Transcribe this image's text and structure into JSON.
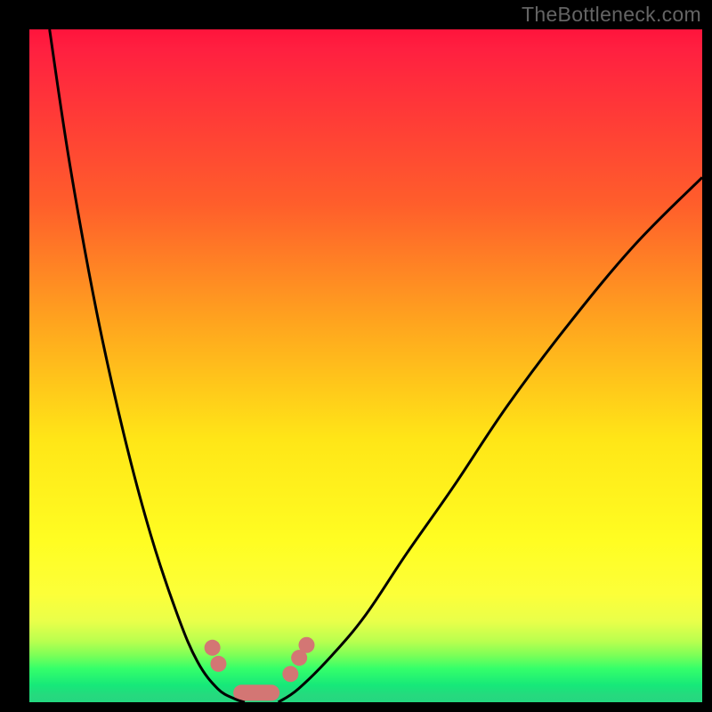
{
  "watermark": "TheBottleneck.com",
  "chart_data": {
    "type": "line",
    "title": "",
    "xlabel": "",
    "ylabel": "",
    "ylim": [
      0,
      100
    ],
    "xlim": [
      0,
      100
    ],
    "background_gradient": {
      "top_color": "#ff143c",
      "mid_color": "#fffd22",
      "bottom_color": "#23d880",
      "description": "vertical heat gradient: red (high bottleneck) at top, through orange/yellow, to green (no bottleneck) at bottom"
    },
    "series": [
      {
        "name": "left-curve",
        "description": "steep descending curve from top-left corner to trough",
        "x": [
          3,
          6,
          10,
          14,
          18,
          22,
          25,
          28,
          30.5,
          32
        ],
        "y": [
          100,
          80,
          58,
          40,
          25,
          13,
          6,
          2,
          0.5,
          0
        ]
      },
      {
        "name": "right-curve",
        "description": "ascending curve from trough toward upper right, flattening",
        "x": [
          37,
          40,
          45,
          50,
          56,
          63,
          71,
          80,
          90,
          100
        ],
        "y": [
          0,
          2,
          7,
          13,
          22,
          32,
          44,
          56,
          68,
          78
        ]
      },
      {
        "name": "highlight-segments",
        "description": "pink pill-shaped highlight markers on/near the curves at the green zone",
        "points": [
          {
            "x": 27.2,
            "y": 8.1
          },
          {
            "x": 28.1,
            "y": 5.7
          },
          {
            "x": 31.5,
            "y": 1.4,
            "end_x": 36.0,
            "end_y": 1.4
          },
          {
            "x": 38.8,
            "y": 4.2
          },
          {
            "x": 40.1,
            "y": 6.6
          },
          {
            "x": 41.2,
            "y": 8.5
          }
        ]
      }
    ],
    "annotations": []
  }
}
